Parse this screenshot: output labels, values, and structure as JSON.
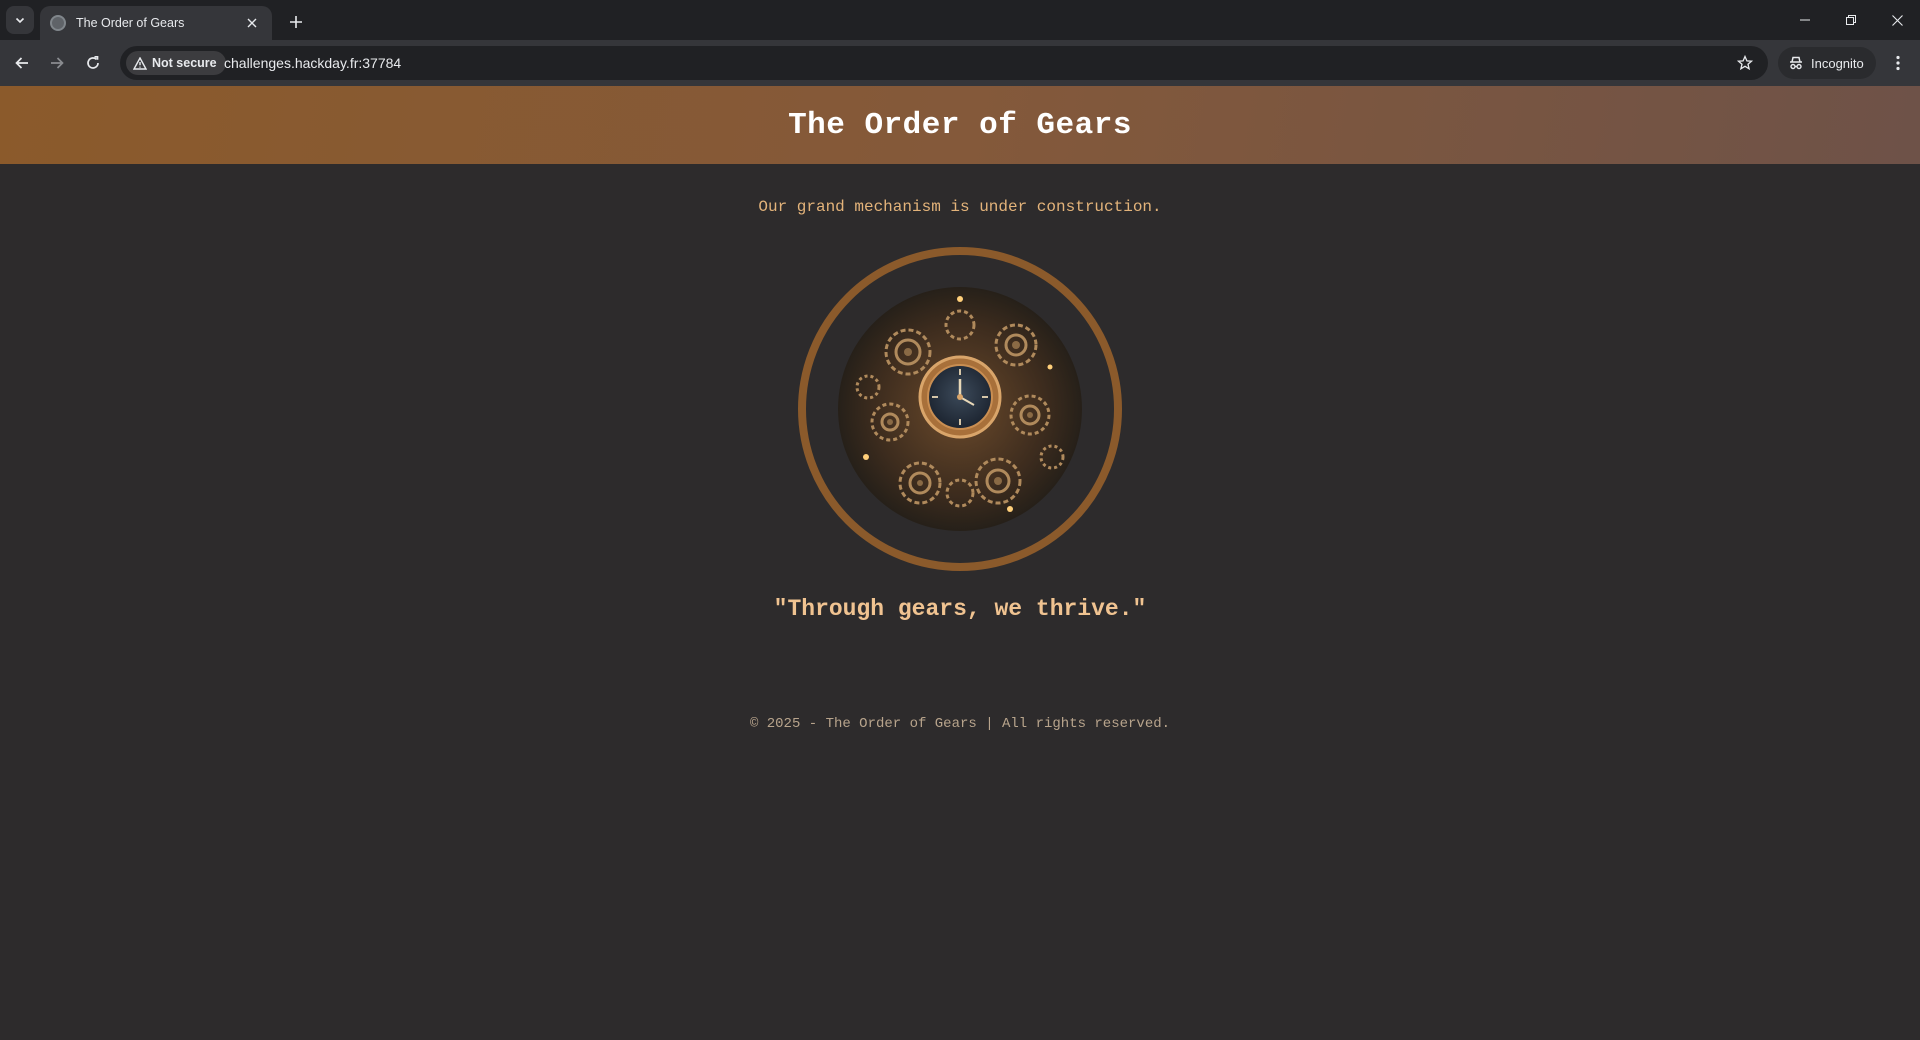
{
  "browser": {
    "tab_title": "The Order of Gears",
    "security_label": "Not secure",
    "url": "challenges.hackday.fr:37784",
    "incognito_label": "Incognito"
  },
  "site": {
    "title": "The Order of Gears",
    "tagline": "Our grand mechanism is under construction.",
    "motto": "\"Through gears, we thrive.\"",
    "footer": "© 2025 - The Order of Gears | All rights reserved."
  },
  "colors": {
    "header_start": "#8b5a2b",
    "header_end": "#6e5248",
    "page_background": "#2d2b2c",
    "accent_text": "#e3b37a",
    "ring": "#8b5a2b"
  },
  "icons": {
    "emblem": "steampunk-gears-clock-icon"
  }
}
